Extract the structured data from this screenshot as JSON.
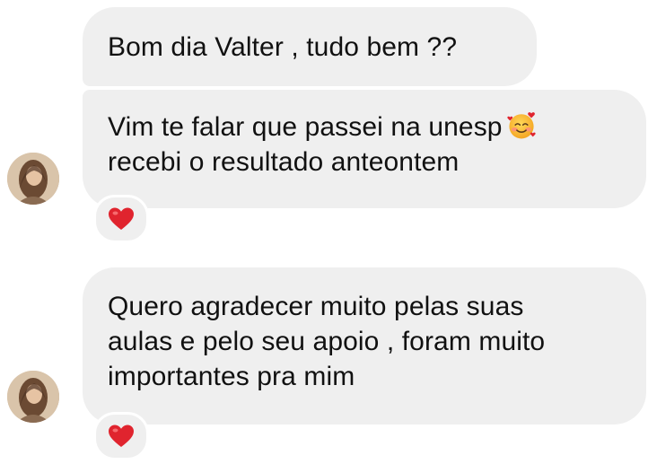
{
  "messages": [
    {
      "lines": [
        "Bom dia Valter , tudo bem ??"
      ]
    },
    {
      "lines": [
        "Vim te falar que passei na unesp",
        "recebi o resultado anteontem"
      ],
      "emoji_icon": "smiling-face-with-hearts-icon",
      "reaction_icon": "red-heart-icon"
    },
    {
      "lines": [
        "Quero agradecer muito pelas suas",
        "aulas e pelo seu apoio , foram muito",
        "importantes pra mim"
      ],
      "reaction_icon": "red-heart-icon"
    }
  ],
  "colors": {
    "bubble_bg": "#efefef",
    "text": "#111111",
    "heart": "#e0242e"
  }
}
